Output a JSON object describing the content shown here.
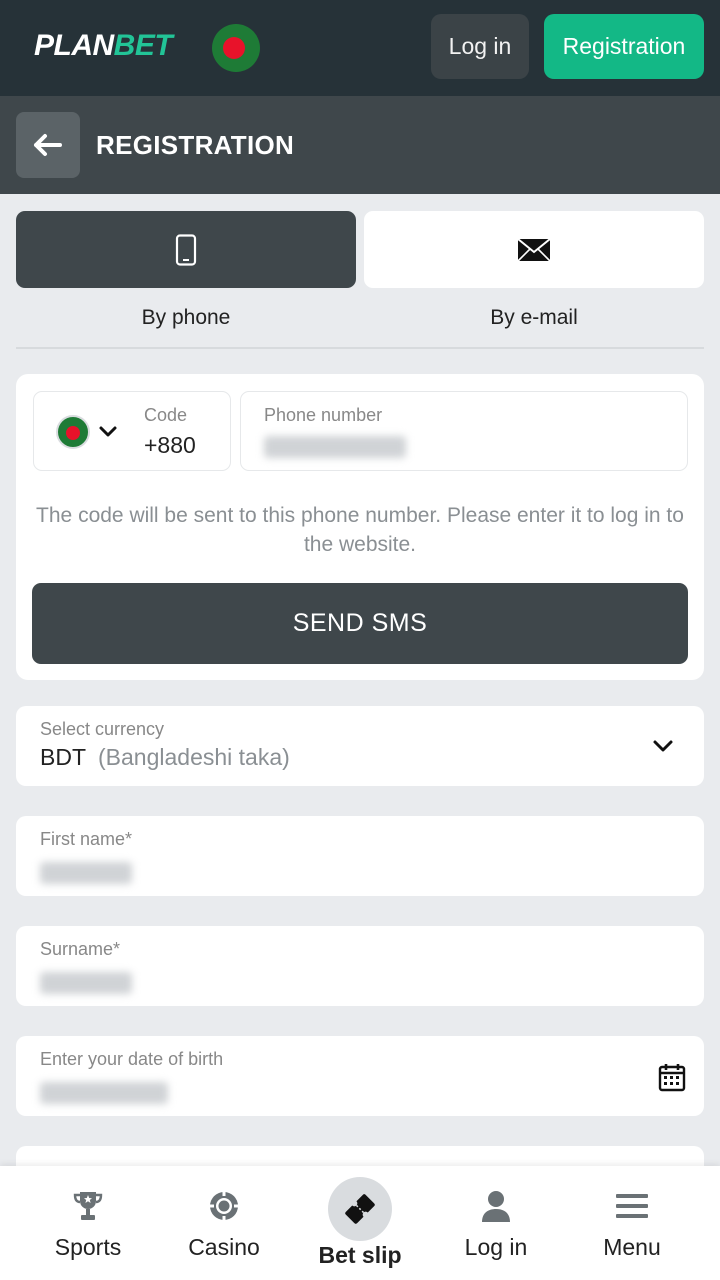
{
  "header": {
    "logo_plan": "PLAN",
    "logo_bet": "BET",
    "login_label": "Log in",
    "register_label": "Registration",
    "accent_color": "#13b886"
  },
  "titlebar": {
    "title": "REGISTRATION",
    "back_icon": "arrow-left-icon"
  },
  "method_tabs": [
    {
      "label": "By phone",
      "icon": "phone-icon",
      "active": true
    },
    {
      "label": "By e-mail",
      "icon": "envelope-icon",
      "active": false
    }
  ],
  "phone_card": {
    "code_label": "Code",
    "code_value": "+880",
    "phone_label": "Phone number",
    "hint": "The code will be sent to this phone number. Please enter it to log in to the website.",
    "send_label": "SEND SMS"
  },
  "fields": {
    "currency": {
      "label": "Select currency",
      "code": "BDT",
      "name": "(Bangladeshi taka)"
    },
    "first_name": {
      "label": "First name*"
    },
    "surname": {
      "label": "Surname*"
    },
    "dob": {
      "label": "Enter your date of birth"
    }
  },
  "bottom_nav": [
    {
      "label": "Sports",
      "icon": "trophy-icon"
    },
    {
      "label": "Casino",
      "icon": "casino-chip-icon"
    },
    {
      "label": "Bet slip",
      "icon": "ticket-icon"
    },
    {
      "label": "Log in",
      "icon": "user-icon"
    },
    {
      "label": "Menu",
      "icon": "hamburger-menu-icon"
    }
  ]
}
